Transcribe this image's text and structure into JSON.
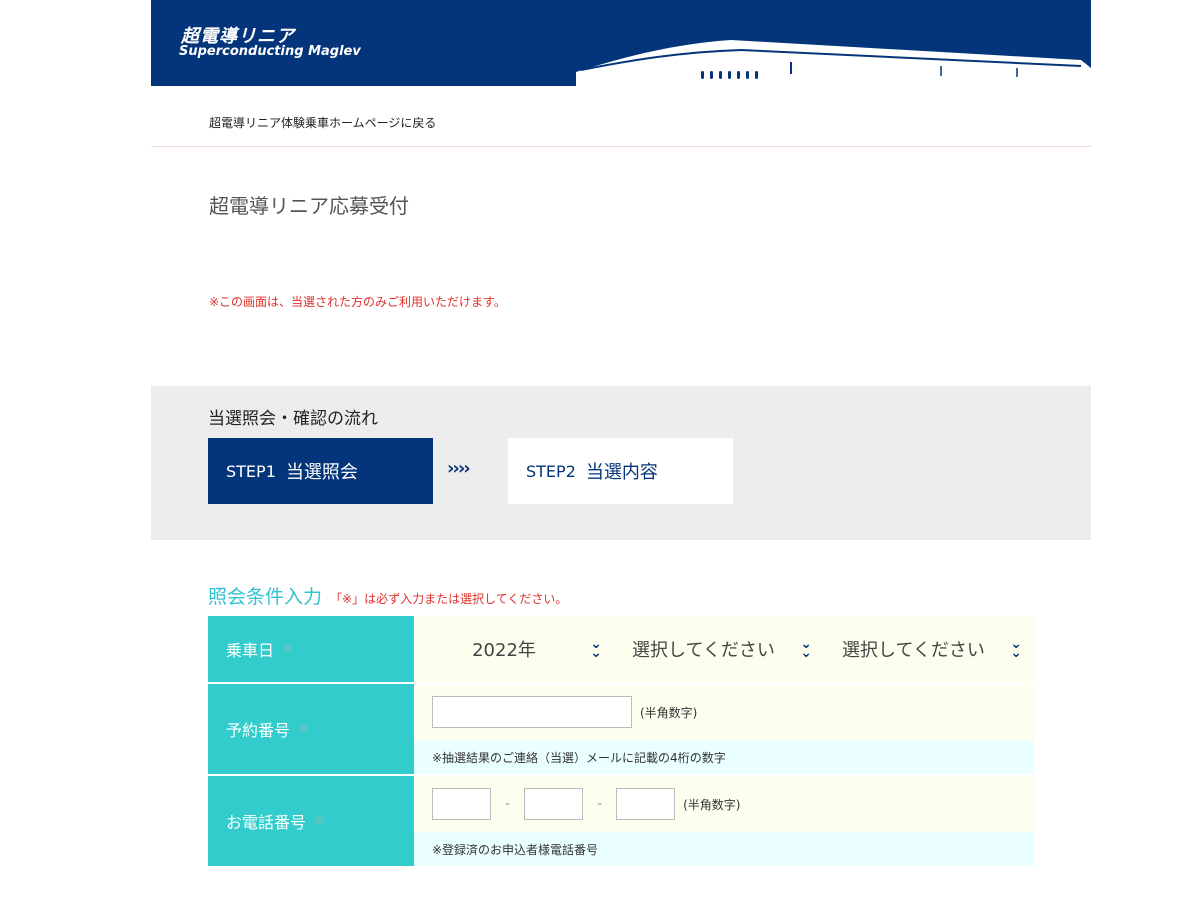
{
  "header": {
    "brand_jp": "超電導リニア",
    "brand_en": "Superconducting Maglev",
    "back_link": "超電導リニア体験乗車ホームページに戻る"
  },
  "page": {
    "title": "超電導リニア応募受付",
    "notice": "※この画面は、当選された方のみご利用いただけます。"
  },
  "flow": {
    "title": "当選照会・確認の流れ",
    "steps": [
      {
        "num": "STEP1",
        "label": "当選照会"
      },
      {
        "num": "STEP2",
        "label": "当選内容"
      }
    ],
    "arrows": "››››"
  },
  "form": {
    "heading": "照会条件入力",
    "required_note": "「※」は必ず入力または選択してください。",
    "required_mark": "※",
    "boarding_date": {
      "label": "乗車日",
      "year": "2022年",
      "month": "選択してください",
      "day": "選択してください"
    },
    "reservation": {
      "label": "予約番号",
      "value": "",
      "unit": "(半角数字)",
      "hint": "※抽選結果のご連絡（当選）メールに記載の4桁の数字"
    },
    "phone": {
      "label": "お電話番号",
      "part1": "",
      "part2": "",
      "part3": "",
      "separator": "-",
      "unit": "(半角数字)",
      "hint": "※登録済のお申込者様電話番号"
    }
  },
  "colors": {
    "navy": "#04357b",
    "teal": "#33cccc",
    "red": "#e0302a",
    "heading_teal": "#33c2d3"
  }
}
